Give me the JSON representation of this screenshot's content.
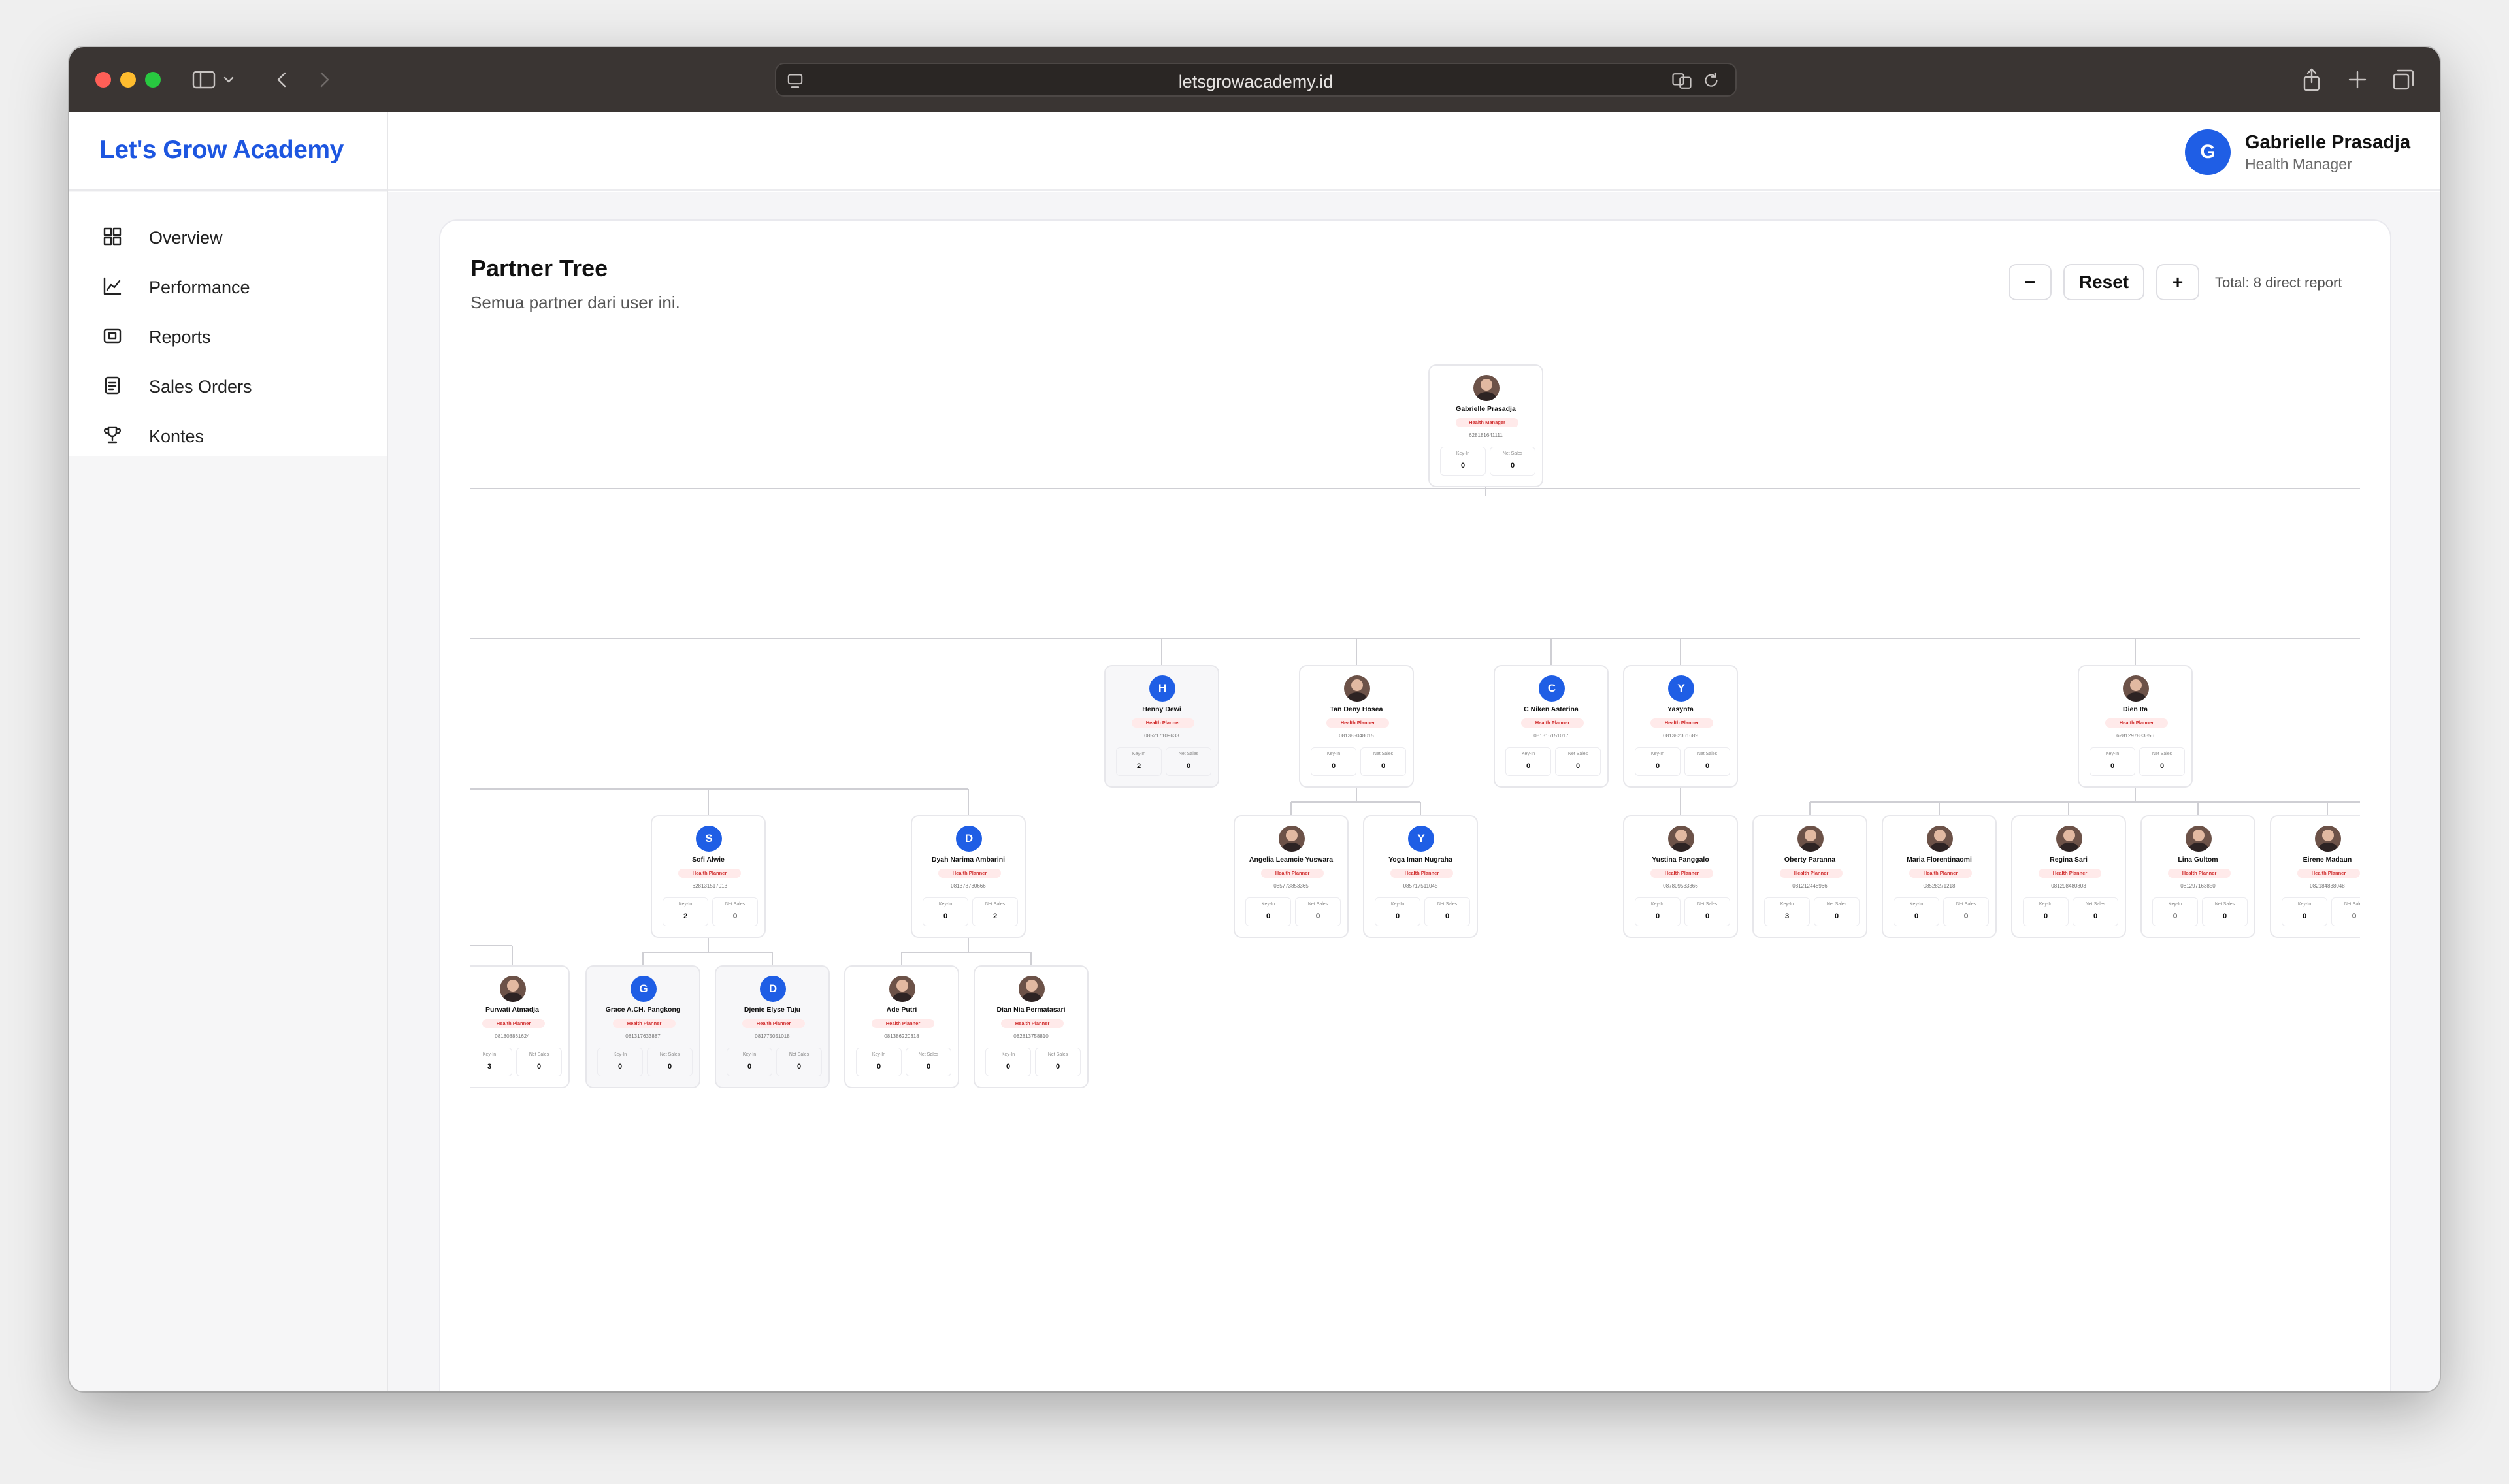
{
  "browser": {
    "url": "letsgrowacademy.id"
  },
  "app": {
    "brand": "Let's Grow Academy"
  },
  "sidebar": {
    "items": [
      {
        "label": "Overview",
        "icon": "grid-icon"
      },
      {
        "label": "Performance",
        "icon": "line-chart-icon"
      },
      {
        "label": "Reports",
        "icon": "report-icon"
      },
      {
        "label": "Sales Orders",
        "icon": "document-icon"
      },
      {
        "label": "Kontes",
        "icon": "trophy-icon"
      }
    ]
  },
  "user": {
    "initial": "G",
    "name": "Gabrielle Prasadja",
    "role": "Health Manager"
  },
  "page": {
    "title": "Partner Tree",
    "subtitle": "Semua partner dari user ini.",
    "zoom_out": "−",
    "reset": "Reset",
    "zoom_in": "+",
    "total": "Total: 8 direct report"
  },
  "stat_labels": {
    "key_in": "Key-In",
    "net_sales": "Net Sales"
  },
  "nodes": [
    {
      "id": "root",
      "name": "Gabrielle Prasadja",
      "role": "Health Manager",
      "phone": "628181641111",
      "key_in": "0",
      "net_sales": "0",
      "avatar": "photo"
    },
    {
      "id": "henny",
      "name": "Henny Dewi",
      "role": "Health Planner",
      "phone": "085217109633",
      "key_in": "2",
      "net_sales": "0",
      "avatar": "H"
    },
    {
      "id": "tan",
      "name": "Tan Deny Hosea",
      "role": "Health Planner",
      "phone": "081385048015",
      "key_in": "0",
      "net_sales": "0",
      "avatar": "photo"
    },
    {
      "id": "niken",
      "name": "C Niken Asterina",
      "role": "Health Planner",
      "phone": "081316151017",
      "key_in": "0",
      "net_sales": "0",
      "avatar": "C"
    },
    {
      "id": "yasynta",
      "name": "Yasynta",
      "role": "Health Planner",
      "phone": "081382361689",
      "key_in": "0",
      "net_sales": "0",
      "avatar": "Y"
    },
    {
      "id": "dien",
      "name": "Dien Ita",
      "role": "Health Planner",
      "phone": "6281297833356",
      "key_in": "0",
      "net_sales": "0",
      "avatar": "photo"
    },
    {
      "id": "sofi",
      "name": "Sofi Alwie",
      "role": "Health Planner",
      "phone": "+628131517013",
      "key_in": "2",
      "net_sales": "0",
      "avatar": "S"
    },
    {
      "id": "dyah",
      "name": "Dyah Narima Ambarini",
      "role": "Health Planner",
      "phone": "081378730666",
      "key_in": "0",
      "net_sales": "2",
      "avatar": "D"
    },
    {
      "id": "angelia",
      "name": "Angelia Leamcie Yuswara",
      "role": "Health Planner",
      "phone": "085773853365",
      "key_in": "0",
      "net_sales": "0",
      "avatar": "photo"
    },
    {
      "id": "yoga",
      "name": "Yoga Iman Nugraha",
      "role": "Health Planner",
      "phone": "085717511045",
      "key_in": "0",
      "net_sales": "0",
      "avatar": "Y"
    },
    {
      "id": "yustina",
      "name": "Yustina Panggalo",
      "role": "Health Planner",
      "phone": "087809533366",
      "key_in": "0",
      "net_sales": "0",
      "avatar": "photo"
    },
    {
      "id": "oberty",
      "name": "Oberty Paranna",
      "role": "Health Planner",
      "phone": "081212448966",
      "key_in": "3",
      "net_sales": "0",
      "avatar": "photo"
    },
    {
      "id": "maria",
      "name": "Maria Florentinaomi",
      "role": "Health Planner",
      "phone": "08528271218",
      "key_in": "0",
      "net_sales": "0",
      "avatar": "photo"
    },
    {
      "id": "regina",
      "name": "Regina Sari",
      "role": "Health Planner",
      "phone": "081298480803",
      "key_in": "0",
      "net_sales": "0",
      "avatar": "photo"
    },
    {
      "id": "lina",
      "name": "Lina Gultom",
      "role": "Health Planner",
      "phone": "081297163850",
      "key_in": "0",
      "net_sales": "0",
      "avatar": "photo"
    },
    {
      "id": "eirene",
      "name": "Eirene Madaun",
      "role": "Health Planner",
      "phone": "082184838048",
      "key_in": "0",
      "net_sales": "0",
      "avatar": "photo"
    },
    {
      "id": "purwati",
      "name": "Purwati Atmadja",
      "role": "Health Planner",
      "phone": "081808861624",
      "key_in": "3",
      "net_sales": "0",
      "avatar": "photo"
    },
    {
      "id": "grace",
      "name": "Grace A.CH. Pangkong",
      "role": "Health Planner",
      "phone": "081317633887",
      "key_in": "0",
      "net_sales": "0",
      "avatar": "G"
    },
    {
      "id": "djenie",
      "name": "Djenie Elyse Tuju",
      "role": "Health Planner",
      "phone": "081775051018",
      "key_in": "0",
      "net_sales": "0",
      "avatar": "D"
    },
    {
      "id": "ade",
      "name": "Ade Putri",
      "role": "Health Planner",
      "phone": "081386220318",
      "key_in": "0",
      "net_sales": "0",
      "avatar": "photo"
    },
    {
      "id": "dian",
      "name": "Dian Nia Permatasari",
      "role": "Health Planner",
      "phone": "082813758810",
      "key_in": "0",
      "net_sales": "0",
      "avatar": "photo"
    }
  ]
}
